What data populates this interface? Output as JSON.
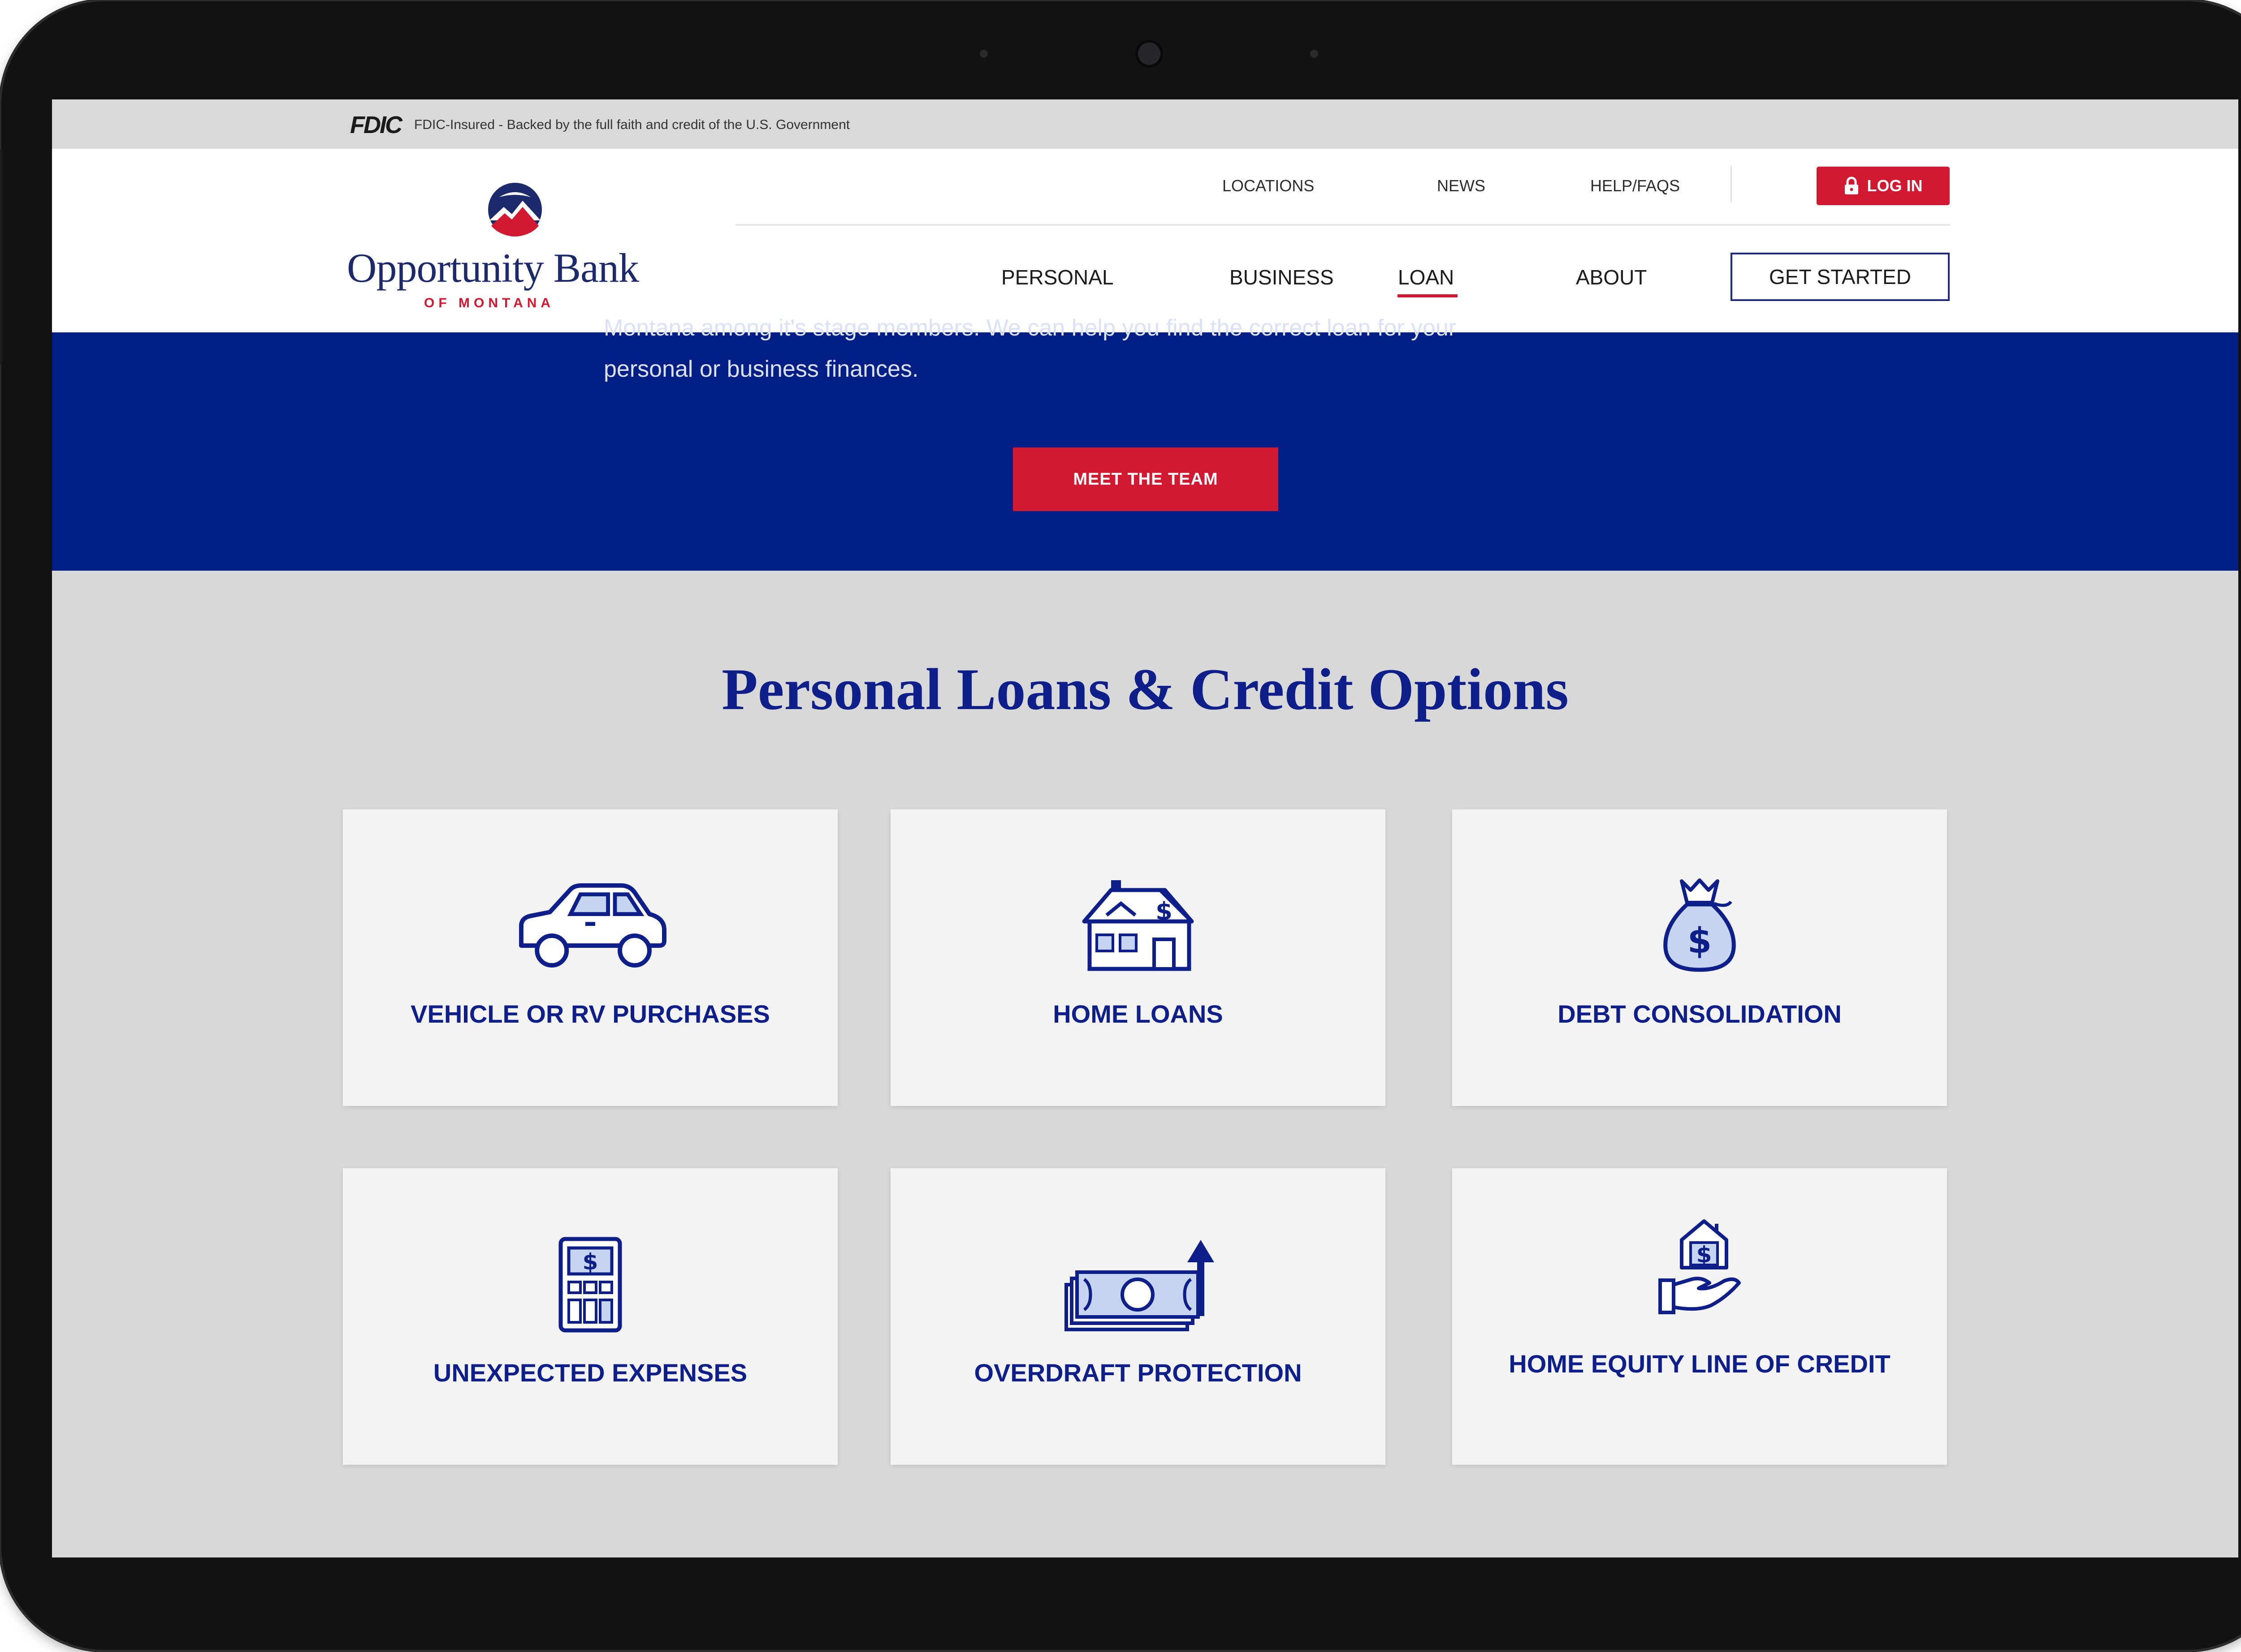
{
  "fdic": {
    "logo": "FDIC",
    "text": "FDIC-Insured - Backed by the full faith and credit of the U.S. Government"
  },
  "brand": {
    "name": "Opportunity Bank",
    "subtitle": "OF MONTANA",
    "colors": {
      "navy": "#001e84",
      "red": "#d11a31",
      "text_blue": "#0f1f8a"
    }
  },
  "utility_nav": {
    "locations": "LOCATIONS",
    "news": "NEWS",
    "help": "HELP/FAQS",
    "login": "LOG IN",
    "login_icon": "lock-icon"
  },
  "main_nav": {
    "personal": "PERSONAL",
    "business": "BUSINESS",
    "loan": "LOAN",
    "about": "ABOUT",
    "active": "LOAN",
    "get_started": "GET STARTED"
  },
  "hero": {
    "line1": "Montana among it's stage members. We can help you find the correct loan for your",
    "line2": "personal or business finances.",
    "button": "MEET THE TEAM"
  },
  "section": {
    "title": "Personal Loans & Credit Options",
    "cards": [
      {
        "label": "VEHICLE OR RV PURCHASES",
        "icon": "car-icon"
      },
      {
        "label": "HOME LOANS",
        "icon": "house-dollar-icon"
      },
      {
        "label": "DEBT CONSOLIDATION",
        "icon": "money-bag-icon"
      },
      {
        "label": "UNEXPECTED EXPENSES",
        "icon": "calculator-icon"
      },
      {
        "label": "OVERDRAFT PROTECTION",
        "icon": "cash-arrow-up-icon"
      },
      {
        "label": "HOME EQUITY LINE OF CREDIT",
        "icon": "hand-house-icon"
      }
    ]
  }
}
